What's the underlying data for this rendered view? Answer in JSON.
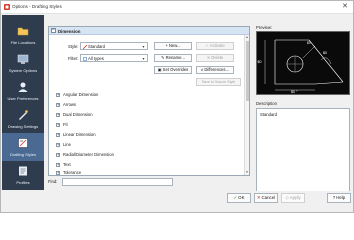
{
  "window": {
    "title": "Options - Drafting Styles",
    "close_glyph": "✕"
  },
  "sidebar": {
    "items": [
      {
        "label": "File Locations",
        "icon": "folder-icon"
      },
      {
        "label": "System Options",
        "icon": "system-icon"
      },
      {
        "label": "User Preferences",
        "icon": "user-icon"
      },
      {
        "label": "Drawing Settings",
        "icon": "drawing-settings-icon"
      },
      {
        "label": "Drafting Styles",
        "icon": "drafting-styles-icon",
        "active": true
      },
      {
        "label": "Profiles",
        "icon": "profiles-icon"
      }
    ]
  },
  "tree": {
    "header": "Dimension",
    "style_label": "Style:",
    "style_value": "Standard",
    "filter_label": "Filter:",
    "filter_value": "All types",
    "buttons": {
      "new": "New...",
      "activate": "Activate",
      "rename": "Rename...",
      "delete": "Delete",
      "set_overrides": "Set Overrides",
      "differences": "Differences...",
      "save_to_source": "Save to Source Style"
    },
    "sections": [
      "Angular Dimension",
      "Arrows",
      "Dual Dimension",
      "Fit",
      "Linear Dimension",
      "Line",
      "Radial/Diameter Dimension",
      "Text",
      "Tolerance"
    ]
  },
  "find": {
    "label": "Find:",
    "value": ""
  },
  "preview": {
    "label": "Preview:",
    "dim_left": "$0",
    "dim_bottom": "$0 °",
    "dim_right": "$0",
    "dim_small": "$0"
  },
  "description": {
    "label": "Description",
    "text": "Standard"
  },
  "footer": {
    "ok": "OK",
    "cancel": "Cancel",
    "apply": "Apply",
    "help": "Help"
  },
  "colors": {
    "sidebar_bg": "#2f3c4d",
    "sidebar_active": "#4a6a93",
    "header_bg": "#d6e4f3",
    "preview_bg": "#0a0a0a"
  }
}
